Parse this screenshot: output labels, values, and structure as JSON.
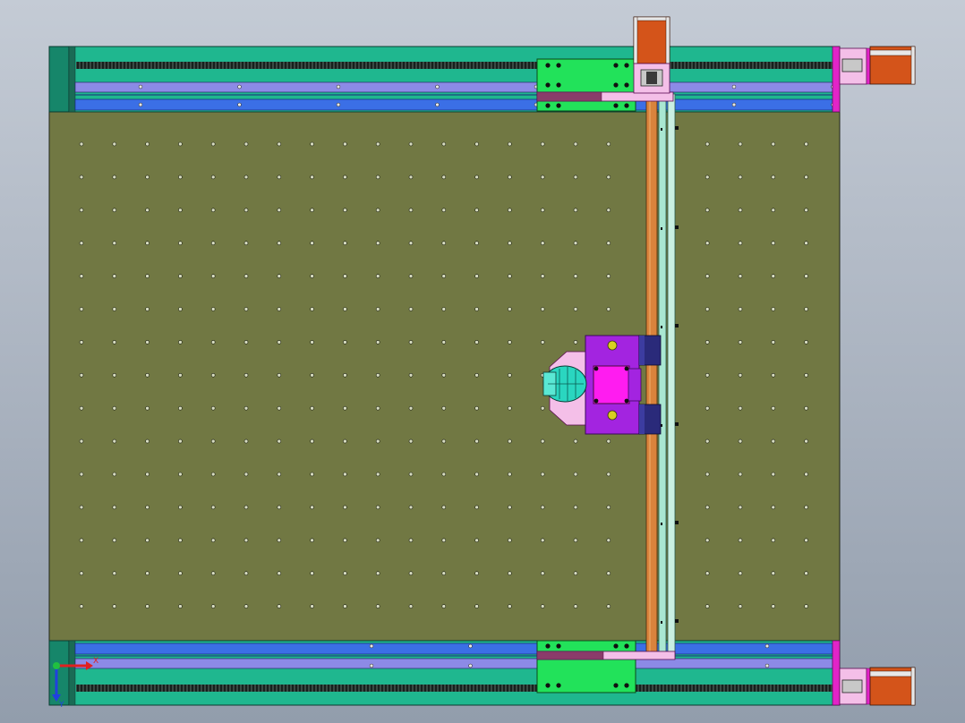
{
  "scene": {
    "view": "top",
    "background_colors": [
      "#c4cbd5",
      "#929dac"
    ],
    "colors": {
      "table": "#717843",
      "frame_teal": "#1fb78f",
      "frame_dark_teal": "#16866a",
      "rail_blue": "#3b6fe6",
      "rail_lavender": "#8c8ae6",
      "rail_dark": "#2a4fb0",
      "belt_black": "#1e2a26",
      "carriage_green": "#22e25a",
      "motor_orange": "#d4541a",
      "bracket_magenta": "#e224c8",
      "gantry_copper": "#d9833c",
      "gantry_mint": "#a9e7d2",
      "tool_purple": "#a324e0",
      "tool_magenta": "#ff1cf0",
      "tool_navy": "#2a2a7a",
      "spindle_cyan": "#2ad6c0",
      "plate_pink": "#f4bfe8",
      "hole": "#d7dcc0",
      "mount_yellow": "#d8d020"
    },
    "hole_grid": {
      "columns": 23,
      "rows": 15
    }
  },
  "triad": {
    "x_label": "X",
    "y_label": "Y",
    "x_color": "#e02020",
    "y_color": "#2040e0",
    "origin_color": "#20c040"
  }
}
